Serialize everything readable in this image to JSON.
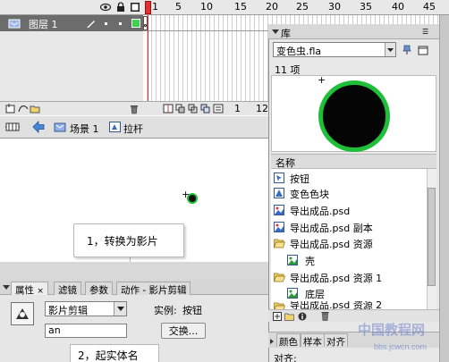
{
  "timeline": {
    "frame_numbers": [
      "1",
      "5",
      "10",
      "15",
      "20",
      "25",
      "30",
      "35",
      "40",
      "45"
    ],
    "layer_name": "图层 1",
    "footer_frame": "1",
    "footer_fps": "12"
  },
  "edit_bar": {
    "scene_label": "场景 1",
    "symbol_label": "拉杆"
  },
  "stage": {
    "callout_1": "1，转换为影片"
  },
  "properties": {
    "tabs": [
      "属性",
      "滤镜",
      "参数",
      "动作 - 影片剪辑"
    ],
    "symbol_type": "影片剪辑",
    "instance_label": "实例:",
    "instance_value": "按钮",
    "instance_name": "an",
    "swap_button": "交换...",
    "callout_2": "2，起实体名"
  },
  "library": {
    "title": "库",
    "file_select": "变色虫.fla",
    "item_count": "11 项",
    "list_header": "名称",
    "items": [
      {
        "label": "按钮",
        "icon": "button-symbol-icon"
      },
      {
        "label": "变色色块",
        "icon": "movieclip-symbol-icon"
      },
      {
        "label": "导出成品.psd",
        "icon": "bitmap-icon"
      },
      {
        "label": "导出成品.psd 副本",
        "icon": "bitmap-icon"
      },
      {
        "label": "导出成品.psd 资源",
        "icon": "folder-open-icon"
      },
      {
        "label": "壳",
        "icon": "bitmap-icon"
      },
      {
        "label": "导出成品.psd 资源 1",
        "icon": "folder-open-icon"
      },
      {
        "label": "底层",
        "icon": "bitmap-icon"
      },
      {
        "label": "导出成品.psd 资源 2",
        "icon": "folder-open-icon"
      }
    ],
    "bottom_tabs": [
      "颜色",
      "样本",
      "对齐"
    ],
    "align_label": "对齐:"
  },
  "watermark": {
    "text": "中国教程网",
    "url": "bbs.jcwcn.com"
  },
  "colors": {
    "accent_green": "#1fbf3a",
    "playhead_red": "#e03030",
    "layer_selected": "#6c6c6c"
  }
}
